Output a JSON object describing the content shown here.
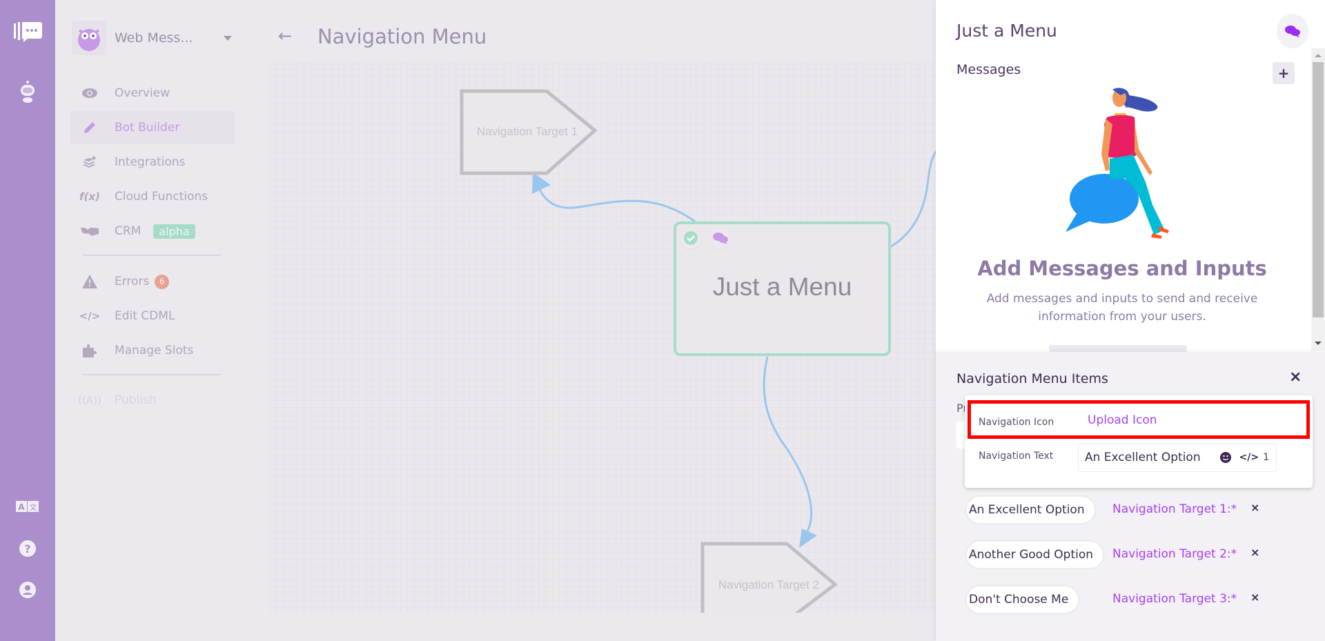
{
  "rail": {
    "icons": [
      "chat-logo-icon",
      "robot-icon",
      "translate-icon",
      "help-icon",
      "user-account-icon"
    ]
  },
  "sidebar": {
    "bot_name": "Web Mess...",
    "items": [
      {
        "label": "Overview",
        "icon": "eye-icon"
      },
      {
        "label": "Bot Builder",
        "icon": "pencil-icon",
        "active": true
      },
      {
        "label": "Integrations",
        "icon": "layers-plus-icon"
      },
      {
        "label": "Cloud Functions",
        "icon": "function-icon"
      },
      {
        "label": "CRM",
        "icon": "handshake-icon",
        "badge": "alpha"
      },
      {
        "label": "Errors",
        "icon": "warning-icon",
        "count": "6"
      },
      {
        "label": "Edit CDML",
        "icon": "code-icon"
      },
      {
        "label": "Manage Slots",
        "icon": "puzzle-icon"
      },
      {
        "label": "Publish",
        "icon": "broadcast-icon",
        "disabled": true
      }
    ]
  },
  "main": {
    "back_label": "←",
    "title": "Navigation Menu",
    "canvas": {
      "center_node": "Just a Menu",
      "targets": [
        "Navigation Target 1",
        "Navigation Target 2"
      ]
    }
  },
  "panel": {
    "title": "Just a Menu",
    "messages_label": "Messages",
    "add_label": "+",
    "empty_title": "Add Messages and Inputs",
    "empty_desc": "Add messages and inputs to send and receive information from your users.",
    "sheet": {
      "title": "Navigation Menu Items",
      "close_label": "×",
      "behind_label": "Pr",
      "popover": {
        "icon_label": "Navigation Icon",
        "upload_label": "Upload Icon",
        "text_label": "Navigation Text",
        "text_value": "An Excellent Option",
        "text_count": "1"
      },
      "options": [
        {
          "text": "An Excellent Option",
          "target": "Navigation Target 1:*"
        },
        {
          "text": "Another Good Option",
          "target": "Navigation Target 2:*"
        },
        {
          "text": "Don't Choose Me",
          "target": "Navigation Target 3:*"
        }
      ],
      "remove_label": "×"
    }
  },
  "colors": {
    "rail": "#ab8fcc",
    "accent": "#a842f0",
    "node_border": "#a7dcc9",
    "edge": "#9ac6ee",
    "highlight": "#ff0000"
  }
}
